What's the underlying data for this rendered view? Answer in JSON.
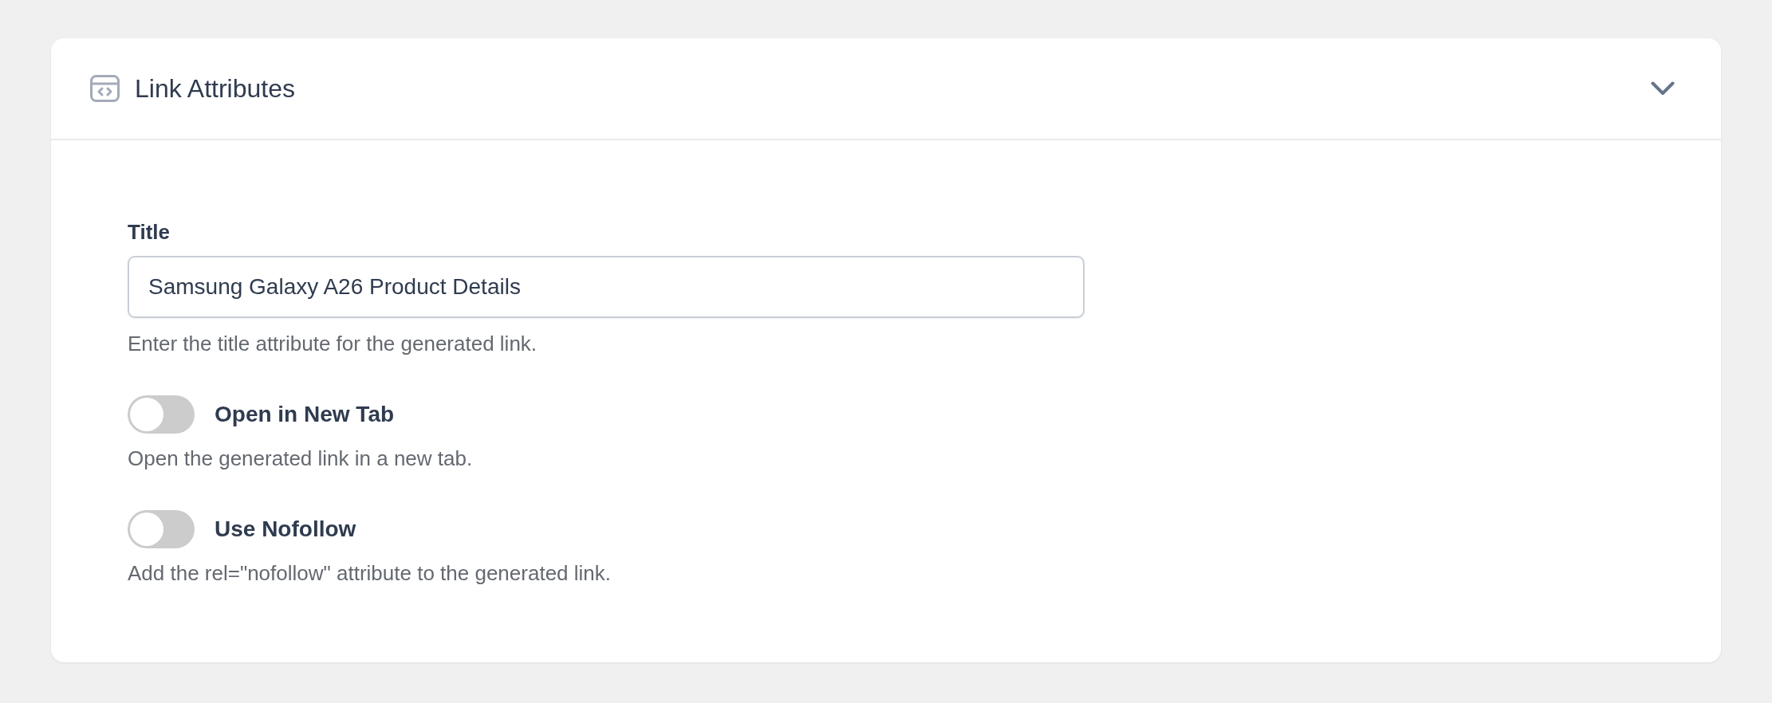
{
  "panel": {
    "title": "Link Attributes",
    "expanded": true
  },
  "fields": [
    {
      "kind": "text",
      "label": "Title",
      "value": "Samsung Galaxy A26 Product Details",
      "help": "Enter the title attribute for the generated link."
    },
    {
      "kind": "toggle",
      "label": "Open in New Tab",
      "on": false,
      "help": "Open the generated link in a new tab."
    },
    {
      "kind": "toggle",
      "label": "Use Nofollow",
      "on": false,
      "help": "Add the rel=\"nofollow\" attribute to the generated link."
    }
  ]
}
